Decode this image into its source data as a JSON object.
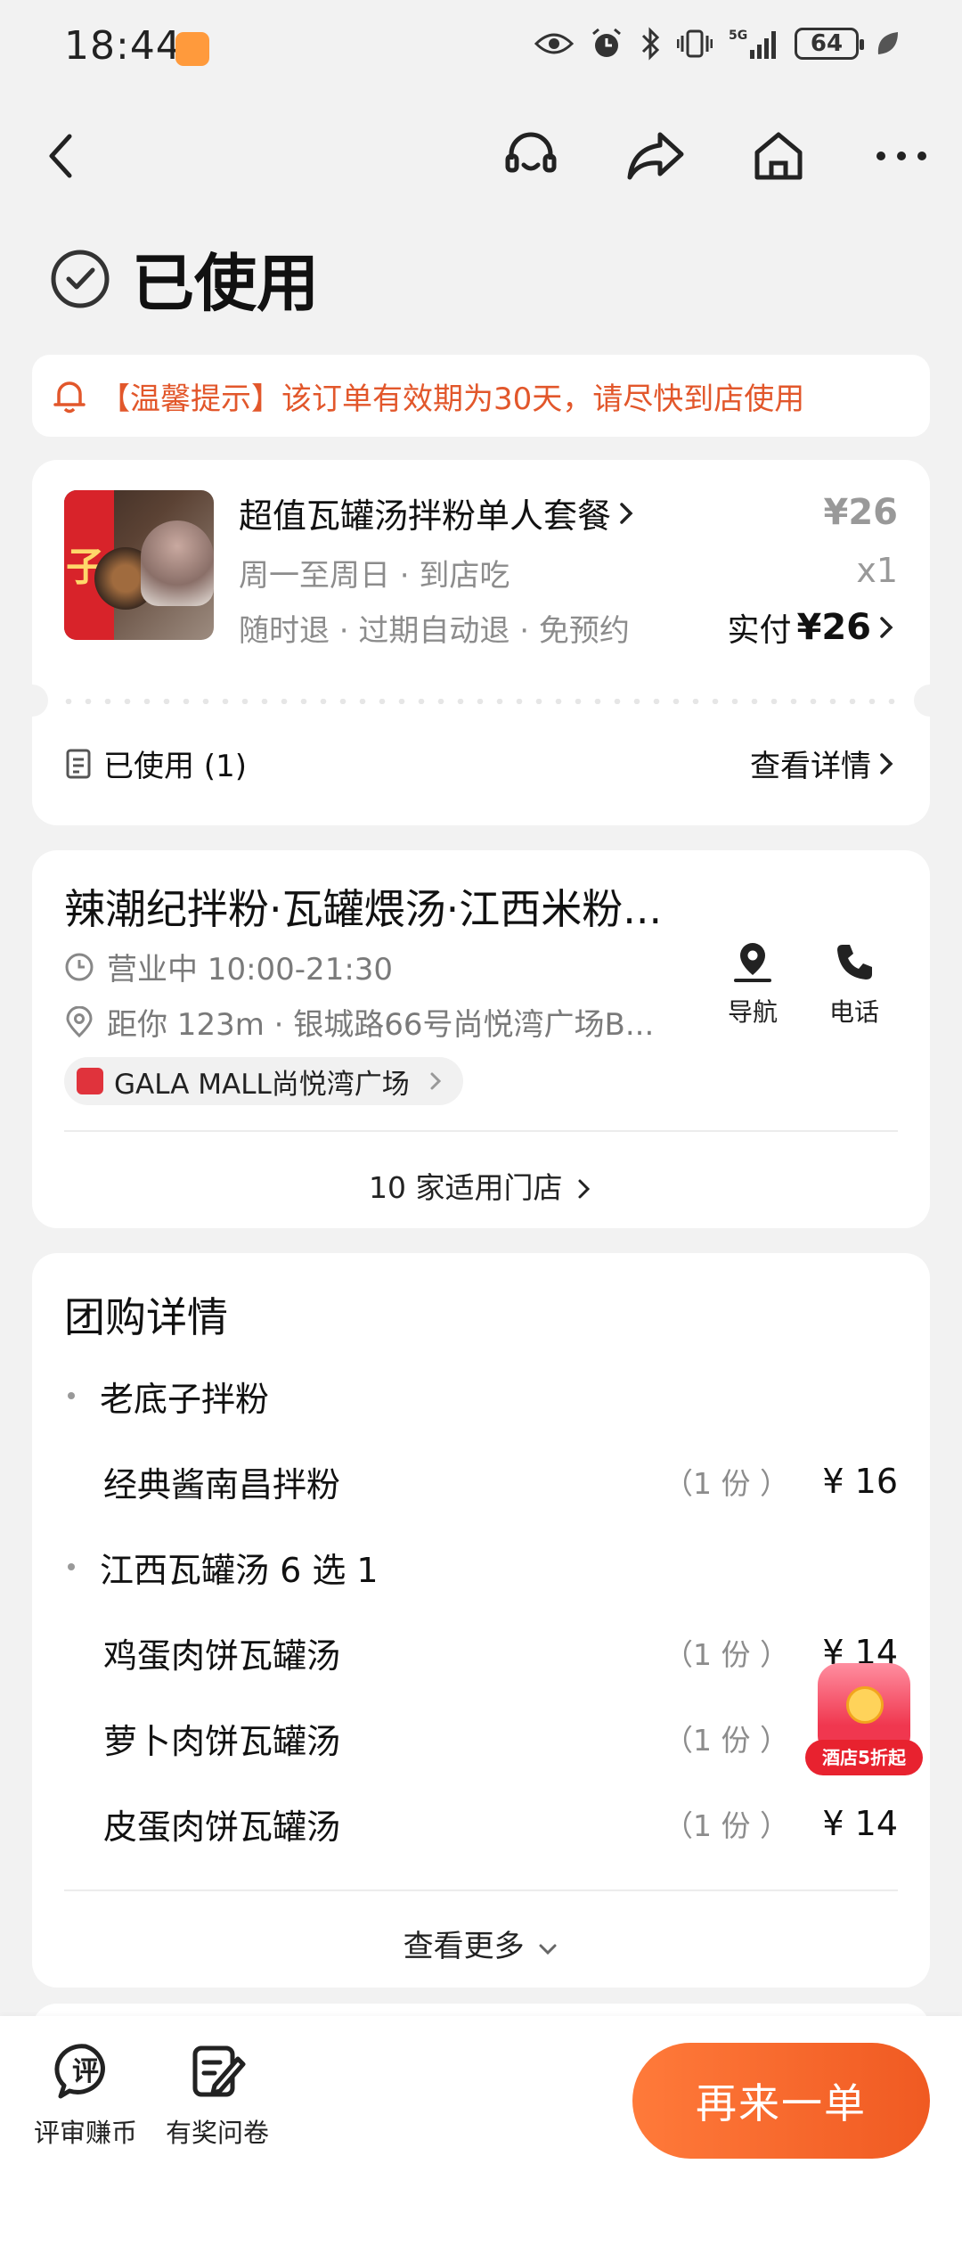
{
  "status_bar": {
    "time": "18:44",
    "network": "5G",
    "battery": "64"
  },
  "title": {
    "status": "已使用"
  },
  "notice": {
    "text": "【温馨提示】该订单有效期为30天，请尽快到店使用"
  },
  "order": {
    "name": "超值瓦罐汤拌粉单人套餐",
    "schedule": "周一至周日 · 到店吃",
    "policy": "随时退 · 过期自动退 · 免预约",
    "original_price": "¥26",
    "quantity": "x1",
    "paid_label": "实付",
    "paid_amount": "¥26",
    "thumb_char": "子",
    "used_label": "已使用 (1)",
    "detail_link": "查看详情"
  },
  "store": {
    "name": "辣潮纪拌粉·瓦罐煨汤·江西米粉...",
    "hours": "营业中 10:00-21:30",
    "address": "距你 123m · 银城路66号尚悦湾广场B...",
    "nav_label": "导航",
    "phone_label": "电话",
    "mall": "GALA MALL尚悦湾广场",
    "applicable_stores": "10 家适用门店"
  },
  "group_detail": {
    "title": "团购详情",
    "groups": [
      {
        "name": "老底子拌粉",
        "items": [
          {
            "name": "经典酱南昌拌粉",
            "portion": "（1 份 ）",
            "price": "¥ 16"
          }
        ]
      },
      {
        "name": "江西瓦罐汤 6 选 1",
        "items": [
          {
            "name": "鸡蛋肉饼瓦罐汤",
            "portion": "（1 份 ）",
            "price": "¥ 14"
          },
          {
            "name": "萝卜肉饼瓦罐汤",
            "portion": "（1 份 ）",
            "price": ""
          },
          {
            "name": "皮蛋肉饼瓦罐汤",
            "portion": "（1 份 ）",
            "price": "¥ 14"
          }
        ]
      }
    ],
    "see_more": "查看更多"
  },
  "promo": {
    "label": "酒店5折起"
  },
  "bottom": {
    "rate_label": "评审赚币",
    "rate_glyph": "评",
    "survey_label": "有奖问卷",
    "reorder_label": "再来一单"
  },
  "colors": {
    "accent": "#f05a22",
    "notice": "#e2572b",
    "background": "#f2f2f2"
  }
}
